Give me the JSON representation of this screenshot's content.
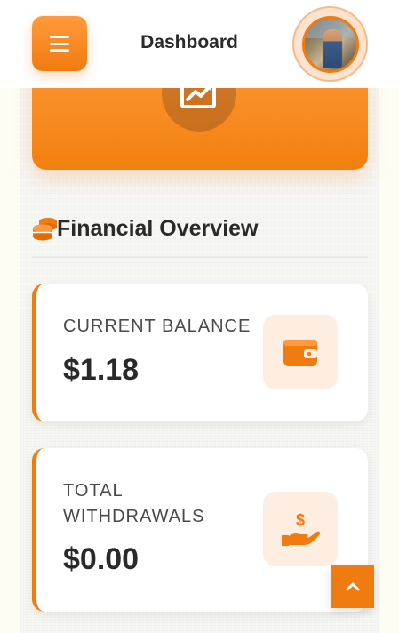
{
  "header": {
    "title": "Dashboard",
    "menu_icon": "hamburger-icon",
    "avatar_icon": "user-avatar"
  },
  "hero": {
    "icon": "chart-line-icon"
  },
  "overview": {
    "title": "Financial Overview",
    "icon": "coins-icon"
  },
  "cards": [
    {
      "label": "Current Balance",
      "value": "$1.18",
      "icon": "wallet-icon"
    },
    {
      "label_line1": "Total",
      "label_line2": "Withdrawals",
      "value": "$0.00",
      "icon": "hand-dollar-icon"
    }
  ],
  "back_to_top": {
    "icon": "chevron-up-icon"
  },
  "colors": {
    "accent": "#f07b10",
    "accent_light": "#ff9a3c",
    "icon_bg": "#fdeee1",
    "text": "#2a2a2a"
  }
}
